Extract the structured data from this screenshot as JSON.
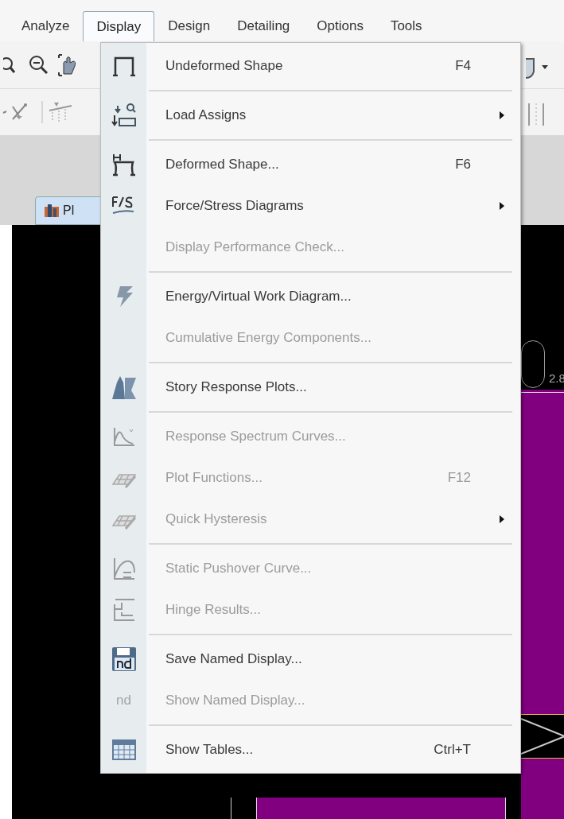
{
  "menu_bar": [
    {
      "label": "Analyze",
      "selected": false
    },
    {
      "label": "Display",
      "selected": true
    },
    {
      "label": "Design",
      "selected": false
    },
    {
      "label": "Detailing",
      "selected": false
    },
    {
      "label": "Options",
      "selected": false
    },
    {
      "label": "Tools",
      "selected": false
    }
  ],
  "view_tab": {
    "label": "Pl"
  },
  "canvas_label": "2.8",
  "menu_groups": [
    {
      "items": [
        {
          "label": "Undeformed Shape",
          "shortcut": "F4",
          "disabled": false,
          "submenu": false
        }
      ]
    },
    {
      "items": [
        {
          "label": "Load Assigns",
          "disabled": false,
          "submenu": true
        }
      ]
    },
    {
      "items": [
        {
          "label": "Deformed Shape...",
          "shortcut": "F6",
          "disabled": false,
          "submenu": false
        },
        {
          "label": "Force/Stress Diagrams",
          "disabled": false,
          "submenu": true
        },
        {
          "label": "Display Performance Check...",
          "disabled": true,
          "submenu": false
        }
      ]
    },
    {
      "items": [
        {
          "label": "Energy/Virtual Work Diagram...",
          "disabled": false,
          "submenu": false
        },
        {
          "label": "Cumulative Energy Components...",
          "disabled": true,
          "submenu": false
        }
      ]
    },
    {
      "items": [
        {
          "label": "Story Response Plots...",
          "disabled": false,
          "submenu": false
        }
      ]
    },
    {
      "items": [
        {
          "label": "Response Spectrum Curves...",
          "disabled": true,
          "submenu": false
        },
        {
          "label": "Plot Functions...",
          "shortcut": "F12",
          "disabled": true,
          "submenu": false
        },
        {
          "label": "Quick Hysteresis",
          "disabled": true,
          "submenu": true
        }
      ]
    },
    {
      "items": [
        {
          "label": "Static Pushover Curve...",
          "disabled": true,
          "submenu": false
        },
        {
          "label": "Hinge Results...",
          "disabled": true,
          "submenu": false
        }
      ]
    },
    {
      "items": [
        {
          "label": "Save Named Display...",
          "disabled": false,
          "submenu": false
        },
        {
          "label": "Show Named Display...",
          "disabled": true,
          "submenu": false,
          "icon_text": "nd"
        }
      ]
    },
    {
      "items": [
        {
          "label": "Show Tables...",
          "shortcut": "Ctrl+T",
          "disabled": false,
          "submenu": false
        }
      ]
    }
  ]
}
